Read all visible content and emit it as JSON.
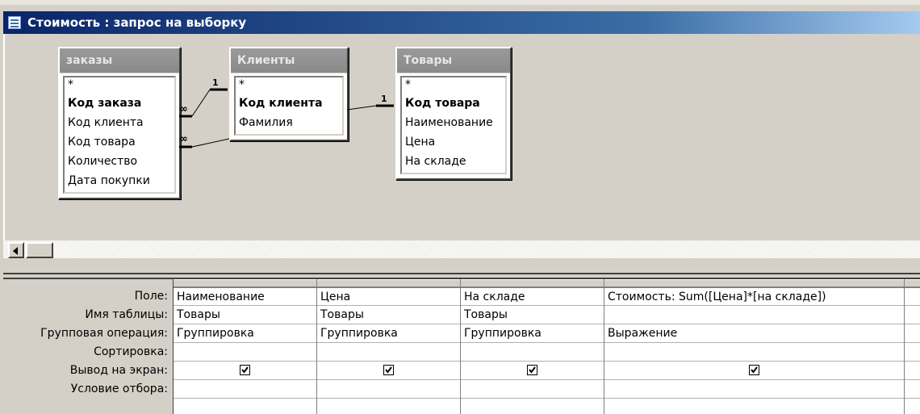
{
  "window": {
    "title": "Стоимость : запрос на выборку"
  },
  "tables": [
    {
      "name": "заказы",
      "fields": [
        {
          "label": "*",
          "key": false
        },
        {
          "label": "Код заказа",
          "key": true
        },
        {
          "label": "Код клиента",
          "key": false
        },
        {
          "label": "Код товара",
          "key": false
        },
        {
          "label": "Количество",
          "key": false
        },
        {
          "label": "Дата покупки",
          "key": false
        }
      ]
    },
    {
      "name": "Клиенты",
      "fields": [
        {
          "label": "*",
          "key": false
        },
        {
          "label": "Код клиента",
          "key": true
        },
        {
          "label": "Фамилия",
          "key": false
        }
      ]
    },
    {
      "name": "Товары",
      "fields": [
        {
          "label": "*",
          "key": false
        },
        {
          "label": "Код товара",
          "key": true
        },
        {
          "label": "Наименование",
          "key": false
        },
        {
          "label": "Цена",
          "key": false
        },
        {
          "label": "На складе",
          "key": false
        }
      ]
    }
  ],
  "relationships": [
    {
      "one": "1",
      "many": "∞"
    },
    {
      "one": "1",
      "many": "∞"
    }
  ],
  "grid": {
    "row_labels": [
      "Поле:",
      "Имя таблицы:",
      "Групповая операция:",
      "Сортировка:",
      "Вывод на экран:",
      "Условие отбора:"
    ],
    "columns": [
      {
        "field": "Наименование",
        "table": "Товары",
        "group": "Группировка",
        "sort": "",
        "show": true,
        "criteria": ""
      },
      {
        "field": "Цена",
        "table": "Товары",
        "group": "Группировка",
        "sort": "",
        "show": true,
        "criteria": ""
      },
      {
        "field": "На складе",
        "table": "Товары",
        "group": "Группировка",
        "sort": "",
        "show": true,
        "criteria": ""
      },
      {
        "field": "Стоимость: Sum([Цена]*[на складе])",
        "table": "",
        "group": "Выражение",
        "sort": "",
        "show": true,
        "criteria": ""
      }
    ]
  }
}
